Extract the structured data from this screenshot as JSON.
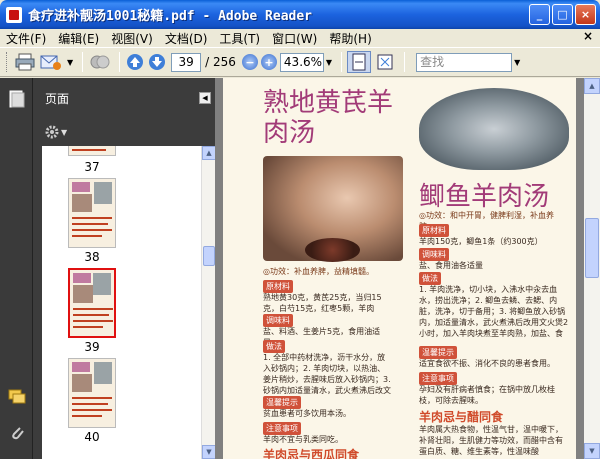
{
  "window": {
    "title": "食疗进补靓汤1001秘籍.pdf - Adobe Reader",
    "buttons": {
      "minimize": "_",
      "maximize": "□",
      "close": "×"
    }
  },
  "menubar": {
    "items": [
      "文件(F)",
      "编辑(E)",
      "视图(V)",
      "文档(D)",
      "工具(T)",
      "窗口(W)",
      "帮助(H)"
    ],
    "close": "×"
  },
  "toolbar": {
    "current_page": "39",
    "total_pages": "/ 256",
    "zoom": "43.6%",
    "search_placeholder": "查找",
    "zoom_out": "−",
    "zoom_in": "+"
  },
  "pages_panel": {
    "title": "页面",
    "options_icon": "gear-icon",
    "thumbnails": [
      {
        "label": "37",
        "selected": false
      },
      {
        "label": "38",
        "selected": false
      },
      {
        "label": "39",
        "selected": true
      },
      {
        "label": "40",
        "selected": false
      }
    ]
  },
  "document": {
    "dish1_title_line1": "熟地黄芪羊",
    "dish1_title_line2": "肉汤",
    "dish2_title": "鲫鱼羊肉汤",
    "dish1_efficacy": "◎功效：补血养脾，益精填髓。",
    "dish2_efficacy": "◎功效：和中开胃，健脾利湿，补血养脾。",
    "labels": {
      "ingredients": "原材料",
      "seasoning": "调味料",
      "method": "做法",
      "tips": "温馨提示",
      "notes": "注意事项"
    },
    "dish1_ingredients": "熟地黄30克，黄芪25克，当归15克，白芍15克，红枣5颗，羊肉500克",
    "dish1_seasoning": "盐、料酒、生姜片5克，食用油适量",
    "dish1_steps": "1. 全部中药材洗净，沥干水分，放入砂锅内；2. 羊肉切块，以热油、姜片稍炒，去腥味后放入砂锅内；3. 砂锅内加适量清水，武火煮沸后改文火煲3小时，加盐、食用油调味即可。",
    "dish1_tip": "贫血患者可多饮用本汤。",
    "dish1_note": "羊肉不宜与乳类同吃。",
    "dish2_ingredients": "羊肉150克，鲫鱼1条（约300克）",
    "dish2_seasoning": "盐、食用油各适量",
    "dish2_steps": "1. 羊肉洗净，切小块，入沸水中汆去血水，捞出洗净；2. 鲫鱼去鳞、去鳃、内脏，洗净，切于备用；3. 将鲫鱼放入砂锅内，加适量清水，武火煮沸后改用文火煲2小时，加入羊肉块煮至羊肉熟，加盐、食用油调味即可。",
    "dish2_tip": "适宜食欲不振、消化不良的患者食用。",
    "dish2_note": "孕妇及有肝病者慎食；在锅中放几枚桂枝，可除去腥味。",
    "section_heading_1": "羊肉忌与醋同食",
    "section_text_1": "羊肉属大热食物，性温气甘，温中暖下，补肾壮阳，生肌健力等功效，而醋中含有蛋白质、糖、维生素等，性温味酸",
    "section_heading_2": "羊肉忌与西瓜同食"
  }
}
